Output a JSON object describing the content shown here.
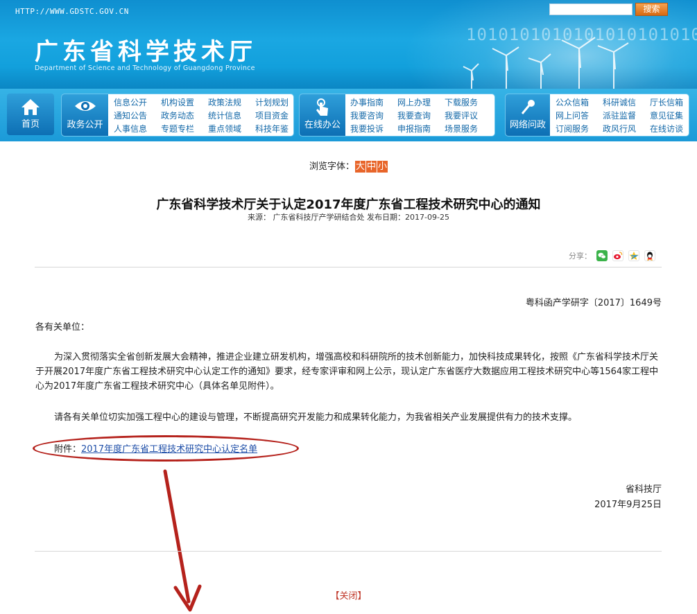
{
  "header": {
    "url_text": "HTTP://WWW.GDSTC.GOV.CN",
    "title": "广东省科学技术厅",
    "subtitle": "Department of Science and Technology of Guangdong Province",
    "binary": "1010101010101010101010",
    "search_placeholder": "",
    "search_button": "搜索"
  },
  "nav": {
    "home": "首页",
    "zwgk": {
      "label": "政务公开",
      "links": [
        "信息公开",
        "机构设置",
        "政策法规",
        "计划规划",
        "通知公告",
        "政务动态",
        "统计信息",
        "项目资金",
        "人事信息",
        "专题专栏",
        "重点领域",
        "科技年鉴"
      ]
    },
    "zxbg": {
      "label": "在线办公",
      "links": [
        "办事指南",
        "网上办理",
        "下载服务",
        "我要咨询",
        "我要查询",
        "我要评议",
        "我要投诉",
        "申报指南",
        "场景服务"
      ]
    },
    "wlwz": {
      "label": "网络问政",
      "links": [
        "公众信箱",
        "科研诚信",
        "厅长信箱",
        "网上问答",
        "派驻监督",
        "意见征集",
        "订阅服务",
        "政风行风",
        "在线访谈"
      ]
    }
  },
  "article": {
    "font_label": "浏览字体：",
    "font_sizes": [
      "大",
      "中",
      "小"
    ],
    "title": "广东省科学技术厅关于认定2017年度广东省工程技术研究中心的通知",
    "meta": "来源：  广东省科技厅产学研结合处   发布日期：2017-09-25",
    "share_label": "分享：",
    "doc_number": "粤科函产学研字〔2017〕1649号",
    "addressee": "各有关单位：",
    "para1": "为深入贯彻落实全省创新发展大会精神，推进企业建立研发机构，增强高校和科研院所的技术创新能力，加快科技成果转化，按照《广东省科学技术厅关于开展2017年度广东省工程技术研究中心认定工作的通知》要求，经专家评审和网上公示，现认定广东省医疗大数据应用工程技术研究中心等1564家工程中心为2017年度广东省工程技术研究中心（具体名单见附件）。",
    "para2": "请各有关单位切实加强工程中心的建设与管理，不断提高研究开发能力和成果转化能力，为我省相关产业发展提供有力的技术支撑。",
    "attachment_label": "附件：",
    "attachment_link": "2017年度广东省工程技术研究中心认定名单",
    "signer": "省科技厅",
    "sign_date": "2017年9月25日",
    "close": "【关闭】"
  },
  "colors": {
    "header_blue": "#1aa7e2",
    "nav_dark": "#0d6fb4",
    "font_button": "#e8652a",
    "annotation_red": "#b5221c",
    "link_blue": "#1f4fa8"
  }
}
